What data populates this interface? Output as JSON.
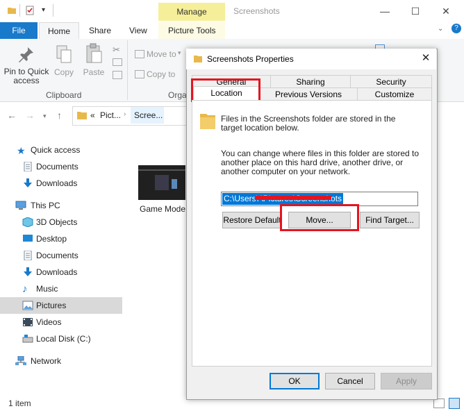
{
  "explorer": {
    "title": "Screenshots",
    "context_tab_group": "Manage",
    "tabs": [
      "File",
      "Home",
      "Share",
      "View",
      "Picture Tools"
    ],
    "ribbon": {
      "pin_label": "Pin to Quick access",
      "copy_label": "Copy",
      "paste_label": "Paste",
      "move_to_label": "Move to",
      "copy_to_label": "Copy to",
      "clipboard_group": "Clipboard",
      "organize_group_partial": "Orga"
    },
    "address": {
      "crumb_prefix": "«",
      "crumb_1": "Pict...",
      "crumb_2": "Scree..."
    },
    "nav": {
      "quick_access": "Quick access",
      "qa_documents": "Documents",
      "qa_downloads": "Downloads",
      "this_pc": "This PC",
      "objects3d": "3D Objects",
      "desktop": "Desktop",
      "documents": "Documents",
      "downloads": "Downloads",
      "music": "Music",
      "pictures": "Pictures",
      "videos": "Videos",
      "local_disk": "Local Disk (C:)",
      "network": "Network"
    },
    "file_item": "Game Mode...",
    "status": "1 item"
  },
  "dialog": {
    "title": "Screenshots Properties",
    "tabs_row1": [
      "General",
      "Sharing",
      "Security"
    ],
    "tabs_row2": [
      "Location",
      "Previous Versions",
      "Customize"
    ],
    "info_text": "Files in the Screenshots folder are stored in the target location below.",
    "change_text": "You can change where files in this folder are stored to another place on this hard drive, another drive, or another computer on your network.",
    "path_value": "C:\\Users\\                    \\Pictures\\Screenshots",
    "buttons": {
      "restore_default": "Restore Default",
      "move": "Move...",
      "find_target": "Find Target...",
      "ok": "OK",
      "cancel": "Cancel",
      "apply": "Apply"
    }
  },
  "colors": {
    "file_tab": "#1979ca",
    "context_tab": "#f6ef99",
    "highlight_annotation": "#e4151f",
    "selection": "#0078d7"
  }
}
